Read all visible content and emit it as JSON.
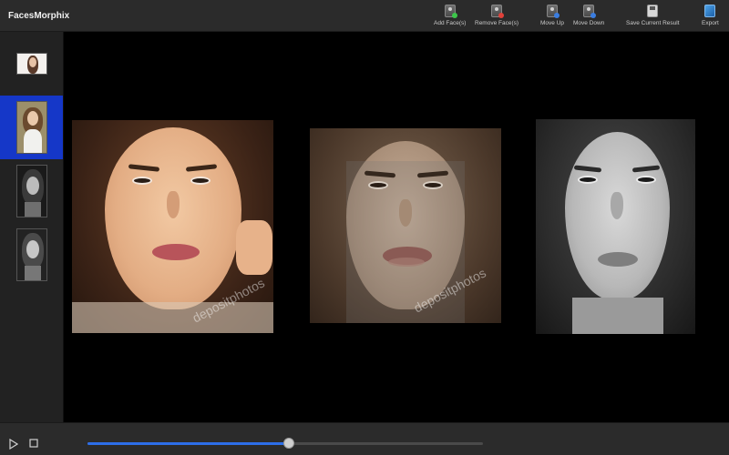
{
  "app": {
    "title": "FacesMorphix"
  },
  "toolbar": {
    "buttons": [
      {
        "label": "Add Face(s)",
        "icon": "add-face-icon"
      },
      {
        "label": "Remove Face(s)",
        "icon": "remove-face-icon"
      },
      {
        "label": "Move Up",
        "icon": "move-up-icon"
      },
      {
        "label": "Move Down",
        "icon": "move-down-icon"
      },
      {
        "label": "Save Current Result",
        "icon": "save-icon"
      },
      {
        "label": "Export",
        "icon": "export-icon"
      }
    ]
  },
  "sidebar": {
    "thumbnails": [
      {
        "name": "face-1",
        "selected": false
      },
      {
        "name": "face-2",
        "selected": true
      },
      {
        "name": "face-3",
        "selected": false
      },
      {
        "name": "face-4",
        "selected": false
      }
    ],
    "selected_color": "#1537c8"
  },
  "stage": {
    "faces": [
      {
        "role": "source",
        "watermark": "depositphotos"
      },
      {
        "role": "morph-result",
        "watermark": "depositphotos"
      },
      {
        "role": "target",
        "watermark": ""
      }
    ]
  },
  "playback": {
    "progress": 0.51,
    "accent": "#2d6ee8"
  }
}
